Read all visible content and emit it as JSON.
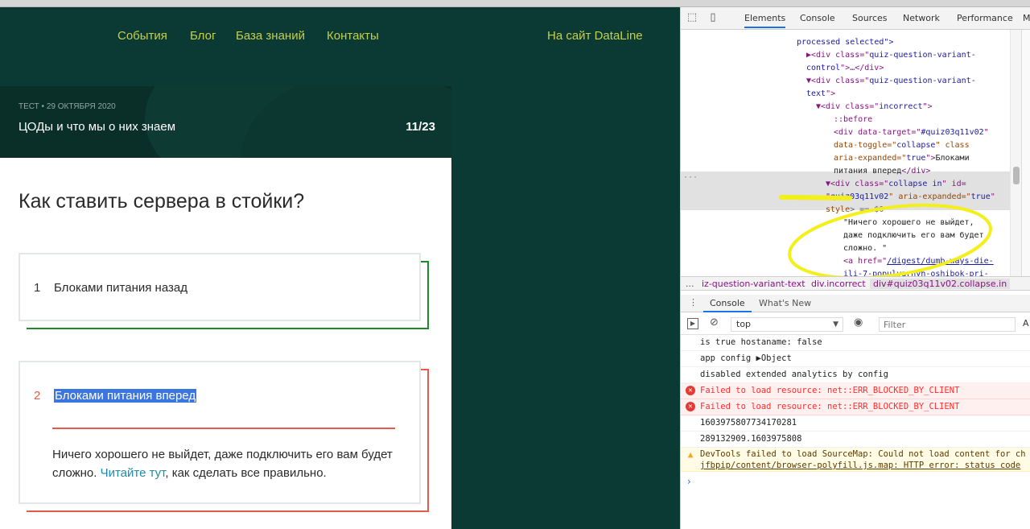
{
  "site": {
    "nav": [
      "События",
      "Блог",
      "База знаний",
      "Контакты"
    ],
    "external_link": "На сайт DataLine",
    "hero": {
      "meta": "ТЕСТ • 29 ОКТЯБРЯ 2020",
      "title": "ЦОДы и что мы о них знаем",
      "counter": "11/23"
    },
    "question": "Как ставить сервера в стойки?",
    "variants": [
      {
        "num": "1",
        "text": "Блоками питания назад",
        "status": "correct"
      },
      {
        "num": "2",
        "text": "Блоками питания вперед",
        "status": "incorrect",
        "explanation_before": "Ничего хорошего не выйдет, даже подключить его вам будет сложно. ",
        "explanation_link": "Читайте тут",
        "explanation_after": ", как сделать все правильно."
      }
    ],
    "colors": {
      "background": "#0b3a34",
      "nav": "#c6cf47",
      "correct": "#1e8a2e",
      "incorrect": "#e55a4a",
      "link": "#1d8ca6"
    }
  },
  "devtools": {
    "tabs": [
      "Elements",
      "Console",
      "Sources",
      "Network",
      "Performance",
      "M"
    ],
    "active_tab": "Elements",
    "dom": {
      "l1": "processed selected\">",
      "l2a": "▶<div class=\"",
      "l2b": "quiz-question-variant-",
      "l3": "control",
      "l3b": "\">…</div>",
      "l4a": "▼<div class=\"",
      "l4b": "quiz-question-variant-",
      "l5": "text",
      "l5b": "\">",
      "l6a": "▼<div class=\"",
      "l6b": "incorrect",
      "l6c": "\">",
      "l7": "::before",
      "l8a": "<div data-target=\"",
      "l8b": "#quiz03q11v02",
      "l8c": "\"",
      "l9a": "data-toggle=\"",
      "l9b": "collapse",
      "l9c": "\" class",
      "l10a": "aria-expanded=\"",
      "l10b": "true",
      "l10c": "\">",
      "l10d": "Блоками",
      "l11a": "питания вперед",
      "l11b": "</div>",
      "l12a": "▼<div class=\"",
      "l12b": "collapse in",
      "l12c": "\" id=",
      "l13a": "\"",
      "l13b": "quiz03q11v02",
      "l13c": "\" aria-expanded=\"",
      "l13d": "true",
      "l13e": "\"",
      "l14a": "style",
      "l14b": "> == $0",
      "l15": "\"Ничего хорошего не выйдет,",
      "l16": "даже подключить его вам будет",
      "l17": "сложно. \"",
      "l18a": "<a href=\"",
      "l18b": "/digest/dumb-ways-die-",
      "l19": "ili-7-populyarnyh-oshibok-pri-"
    },
    "dots": "···",
    "breadcrumbs": [
      "...",
      "iz-question-variant-text",
      "div.incorrect",
      "div#quiz03q11v02.collapse.in"
    ],
    "drawer_tabs": [
      "Console",
      "What's New"
    ],
    "console_context": "top",
    "filter_placeholder": "Filter",
    "levels_label": "A",
    "messages": [
      {
        "type": "log",
        "text": "is true hostaname: false"
      },
      {
        "type": "log",
        "text": "app config ▶Object"
      },
      {
        "type": "log",
        "text": "disabled extended analytics by config"
      },
      {
        "type": "error",
        "text": "Failed to load resource: net::ERR_BLOCKED_BY_CLIENT"
      },
      {
        "type": "error",
        "text": "Failed to load resource: net::ERR_BLOCKED_BY_CLIENT"
      },
      {
        "type": "log",
        "text": "1603975807734170281"
      },
      {
        "type": "log",
        "text": "289132909.1603975808"
      },
      {
        "type": "warn",
        "text": "DevTools failed to load SourceMap: Could not load content for ch",
        "text2": "jfbpip/content/browser-polyfill.js.map: HTTP error: status code"
      }
    ],
    "prompt": "›"
  }
}
